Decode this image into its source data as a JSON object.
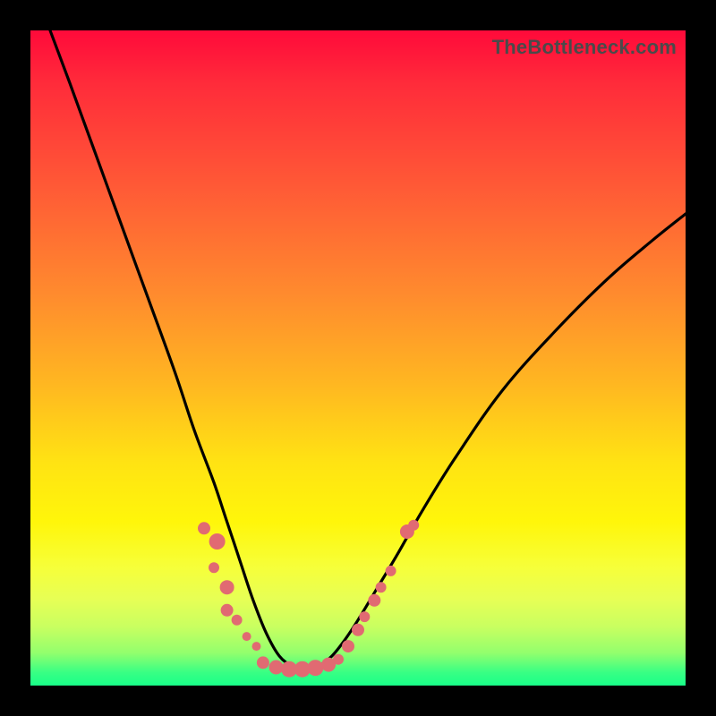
{
  "watermark": "TheBottleneck.com",
  "colors": {
    "frame": "#000000",
    "curve": "#000000",
    "dot": "#e16a72",
    "gradient_top": "#ff0a3a",
    "gradient_bottom": "#19ff88"
  },
  "chart_data": {
    "type": "line",
    "title": "",
    "xlabel": "",
    "ylabel": "",
    "xlim": [
      0,
      100
    ],
    "ylim": [
      0,
      100
    ],
    "curve": {
      "comment": "V-shaped bottleneck curve; x is normalized 0-100 across plot width, y is bottleneck percent (0 at valley floor, 100 at top). Curve starts at x≈3 y=100, dives to a flat valley y≈2.5 around x≈36-45, then rises to y≈72 at x=100.",
      "x": [
        3,
        6,
        10,
        14,
        18,
        22,
        25,
        28,
        30,
        32,
        34,
        36,
        38,
        40,
        42,
        44,
        46,
        48,
        50,
        53,
        56,
        60,
        65,
        72,
        80,
        88,
        95,
        100
      ],
      "y": [
        100,
        92,
        81,
        70,
        59,
        48,
        39,
        31,
        25,
        19,
        13,
        8,
        4.5,
        3,
        2.5,
        3,
        4.5,
        7,
        10,
        15,
        20,
        27,
        35,
        45,
        54,
        62,
        68,
        72
      ]
    },
    "dots": {
      "comment": "Salmon data markers clustered on both walls of the V and along the valley floor; (x,y) same normalized coords as curve.",
      "points": [
        {
          "x": 26.5,
          "y": 24.0,
          "r": 7
        },
        {
          "x": 28.5,
          "y": 22.0,
          "r": 9
        },
        {
          "x": 28.0,
          "y": 18.0,
          "r": 6
        },
        {
          "x": 30.0,
          "y": 15.0,
          "r": 8
        },
        {
          "x": 30.0,
          "y": 11.5,
          "r": 7
        },
        {
          "x": 31.5,
          "y": 10.0,
          "r": 6
        },
        {
          "x": 33.0,
          "y": 7.5,
          "r": 5
        },
        {
          "x": 34.5,
          "y": 6.0,
          "r": 5
        },
        {
          "x": 35.5,
          "y": 3.5,
          "r": 7
        },
        {
          "x": 37.5,
          "y": 2.8,
          "r": 8
        },
        {
          "x": 39.5,
          "y": 2.5,
          "r": 9
        },
        {
          "x": 41.5,
          "y": 2.5,
          "r": 9
        },
        {
          "x": 43.5,
          "y": 2.7,
          "r": 9
        },
        {
          "x": 45.5,
          "y": 3.2,
          "r": 8
        },
        {
          "x": 47.0,
          "y": 4.0,
          "r": 6
        },
        {
          "x": 48.5,
          "y": 6.0,
          "r": 7
        },
        {
          "x": 50.0,
          "y": 8.5,
          "r": 7
        },
        {
          "x": 51.0,
          "y": 10.5,
          "r": 6
        },
        {
          "x": 52.5,
          "y": 13.0,
          "r": 7
        },
        {
          "x": 53.5,
          "y": 15.0,
          "r": 6
        },
        {
          "x": 55.0,
          "y": 17.5,
          "r": 6
        },
        {
          "x": 57.5,
          "y": 23.5,
          "r": 8
        },
        {
          "x": 58.5,
          "y": 24.5,
          "r": 6
        }
      ]
    }
  }
}
